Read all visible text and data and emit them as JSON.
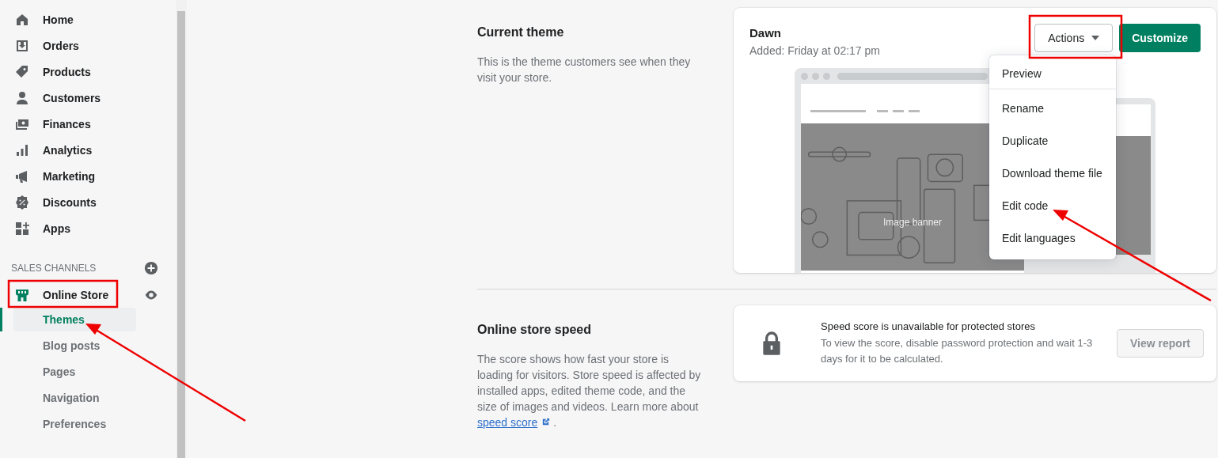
{
  "sidebar": {
    "items": [
      {
        "label": "Home",
        "selected": false
      },
      {
        "label": "Orders",
        "selected": false
      },
      {
        "label": "Products",
        "selected": false
      },
      {
        "label": "Customers",
        "selected": false
      },
      {
        "label": "Finances",
        "selected": false
      },
      {
        "label": "Analytics",
        "selected": false
      },
      {
        "label": "Marketing",
        "selected": false
      },
      {
        "label": "Discounts",
        "selected": false
      },
      {
        "label": "Apps",
        "selected": false
      }
    ],
    "sales_channels": {
      "heading": "SALES CHANNELS",
      "channels": [
        {
          "label": "Online Store",
          "children": [
            {
              "label": "Themes",
              "selected": true
            },
            {
              "label": "Blog posts",
              "selected": false
            },
            {
              "label": "Pages",
              "selected": false
            },
            {
              "label": "Navigation",
              "selected": false
            },
            {
              "label": "Preferences",
              "selected": false
            }
          ]
        }
      ]
    }
  },
  "current_theme": {
    "title": "Current theme",
    "description": "This is the theme customers see when they visit your store.",
    "theme": {
      "name": "Dawn",
      "added": "Added: Friday at 02:17 pm"
    },
    "actions_button": "Actions",
    "customize_button": "Customize",
    "actions_menu": {
      "expanded": true,
      "items": [
        "Preview",
        "Rename",
        "Duplicate",
        "Download theme file",
        "Edit code",
        "Edit languages"
      ]
    },
    "preview": {
      "banner_title": "Image banner"
    }
  },
  "store_speed": {
    "title": "Online store speed",
    "description": "The score shows how fast your store is loading for visitors. Store speed is affected by installed apps, edited theme code, and the size of images and videos. Learn more about",
    "link": "speed score",
    "after_link": ".",
    "notice_title": "Speed score is unavailable for protected stores",
    "notice_text": "To view the score, disable password protection and wait 1-3 days for it to be calculated.",
    "button": "View report"
  }
}
